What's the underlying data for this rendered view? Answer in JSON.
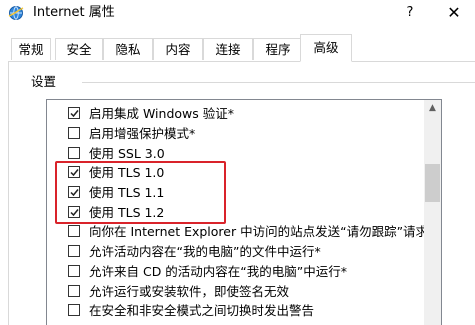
{
  "window": {
    "title": "Internet 属性",
    "help_label": "?",
    "close_label": "✕"
  },
  "tabs": [
    "常规",
    "安全",
    "隐私",
    "内容",
    "连接",
    "程序",
    "高级"
  ],
  "active_tab": "高级",
  "settings": {
    "group_label": "设置",
    "items": [
      {
        "label": "启用集成 Windows 验证*",
        "checked": true
      },
      {
        "label": "启用增强保护模式*",
        "checked": false
      },
      {
        "label": "使用 SSL 3.0",
        "checked": false
      },
      {
        "label": "使用 TLS 1.0",
        "checked": true
      },
      {
        "label": "使用 TLS 1.1",
        "checked": true
      },
      {
        "label": "使用 TLS 1.2",
        "checked": true
      },
      {
        "label": "向你在 Internet Explorer 中访问的站点发送“请勿跟踪”请求*",
        "checked": false
      },
      {
        "label": "允许活动内容在“我的电脑”的文件中运行*",
        "checked": false
      },
      {
        "label": "允许来自 CD 的活动内容在“我的电脑”中运行*",
        "checked": false
      },
      {
        "label": "允许运行或安装软件，即使签名无效",
        "checked": false
      },
      {
        "label": "在安全和非安全模式之间切换时发出警告",
        "checked": false
      }
    ]
  },
  "colors": {
    "highlight_border": "#d9232a",
    "ie_icon": "#1e7ad6"
  },
  "icons": {
    "title": "internet-options-globe-icon",
    "scroll_up": "scroll-up-arrow-icon"
  }
}
